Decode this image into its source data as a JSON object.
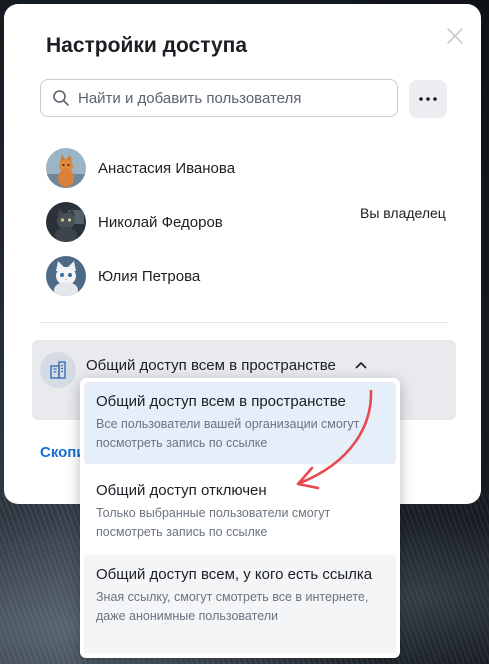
{
  "dialog": {
    "title": "Настройки доступа"
  },
  "search": {
    "placeholder": "Найти и добавить пользователя"
  },
  "users": [
    {
      "name": "Анастасия Иванова",
      "avatar_icon": "cat-avatar-orange"
    },
    {
      "name": "Николай Федоров",
      "avatar_icon": "cat-avatar-dark"
    },
    {
      "name": "Юлия Петрова",
      "avatar_icon": "cat-avatar-white"
    }
  ],
  "owner_label": "Вы владелец",
  "access": {
    "current": "Общий доступ всем в пространстве",
    "options": [
      {
        "title": "Общий доступ всем в пространстве",
        "description": "Все пользователи вашей организации смогут посмотреть запись по ссылке",
        "selected": true
      },
      {
        "title": "Общий доступ отключен",
        "description": "Только выбранные пользователи смогут посмотреть запись по ссылке",
        "selected": false
      },
      {
        "title": "Общий доступ всем, у кого есть ссылка",
        "description": "Зная ссылку, смогут смотреть все в интернете, даже анонимные пользователи",
        "selected": false
      }
    ]
  },
  "copy_link_label": "Скопировать ссылку",
  "colors": {
    "accent": "#1a6fd6",
    "selected_option_bg": "#e6eef9",
    "annotation_arrow": "#e8484f"
  }
}
